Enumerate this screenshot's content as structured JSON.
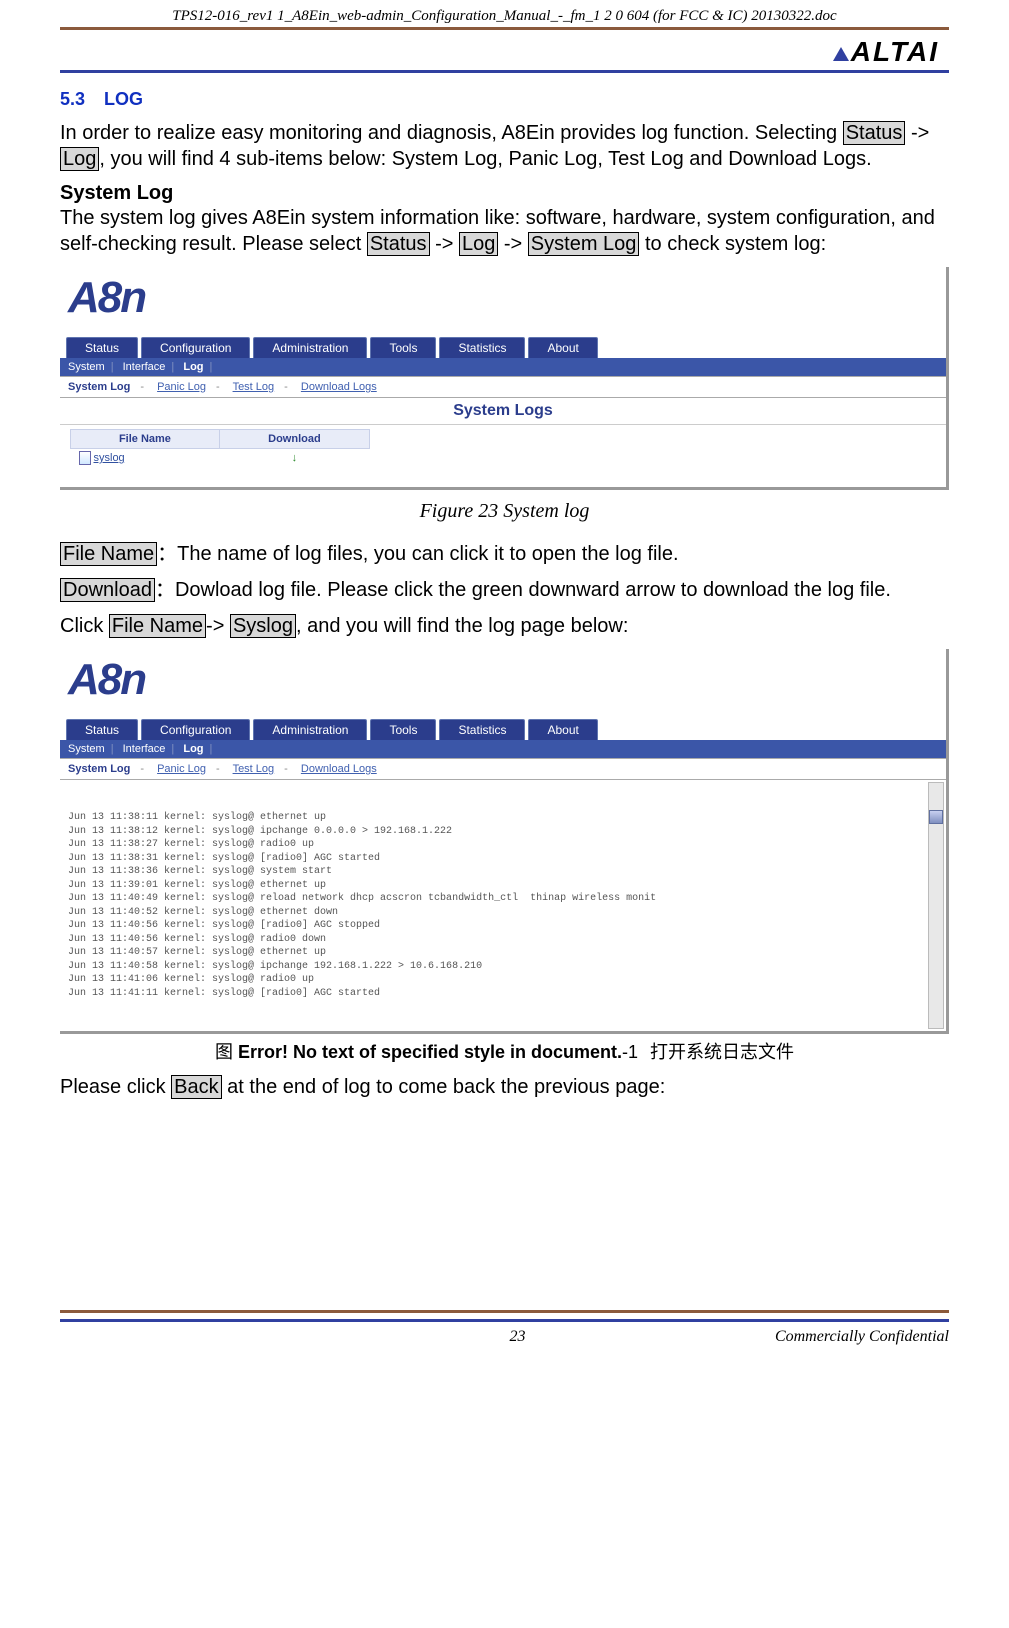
{
  "doc_header": "TPS12-016_rev1 1_A8Ein_web-admin_Configuration_Manual_-_fm_1 2 0 604 (for FCC & IC) 20130322.doc",
  "logo_text": "ALTAI",
  "section": {
    "num": "5.3",
    "title": "LOG"
  },
  "intro": {
    "p1a": "In order to realize easy monitoring and diagnosis, A8Ein provides log function. Selecting ",
    "status": "Status",
    "arrow1": " -> ",
    "log": "Log",
    "p1b": ", you will find 4 sub-items below: System Log, Panic Log, Test Log and Download Logs."
  },
  "syslog_heading": "System Log",
  "syslog_desc": {
    "a": "The system log gives A8Ein system information like: software, hardware, system configuration, and self-checking result. Please select ",
    "status": "Status",
    "arr": " -> ",
    "log": "Log",
    "systemlog": "System Log",
    "b": " to check system log:"
  },
  "a8n_logo": "A8n",
  "main_tabs": [
    "Status",
    "Configuration",
    "Administration",
    "Tools",
    "Statistics",
    "About"
  ],
  "sub_nav": {
    "items": [
      "System",
      "Interface",
      "Log"
    ],
    "active": "Log"
  },
  "log_tabs": [
    "System Log",
    "Panic Log",
    "Test Log",
    "Download Logs"
  ],
  "panel_title": "System Logs",
  "table": {
    "headers": [
      "File Name",
      "Download"
    ],
    "row": {
      "name": "syslog"
    }
  },
  "figure_caption": "Figure 23 System log",
  "filename_label": "File Name",
  "filename_desc": "：The name of log files, you can click it to open the log file.",
  "download_label": "Download",
  "download_desc": "：Dowload log file. Please click the green downward arrow to download the log file.",
  "click_line": {
    "a": "Click ",
    "fn": "File Name",
    "arr": "-> ",
    "sl": "Syslog",
    "b": ", and you will find the log page below:"
  },
  "log_lines": [
    "Jun 13 11:38:11 kernel: syslog@ ethernet up",
    "Jun 13 11:38:12 kernel: syslog@ ipchange 0.0.0.0 > 192.168.1.222",
    "Jun 13 11:38:27 kernel: syslog@ radio0 up",
    "Jun 13 11:38:31 kernel: syslog@ [radio0] AGC started",
    "Jun 13 11:38:36 kernel: syslog@ system start",
    "Jun 13 11:39:01 kernel: syslog@ ethernet up",
    "Jun 13 11:40:49 kernel: syslog@ reload network dhcp acscron tcbandwidth_ctl  thinap wireless monit",
    "Jun 13 11:40:52 kernel: syslog@ ethernet down",
    "Jun 13 11:40:56 kernel: syslog@ [radio0] AGC stopped",
    "Jun 13 11:40:56 kernel: syslog@ radio0 down",
    "Jun 13 11:40:57 kernel: syslog@ ethernet up",
    "Jun 13 11:40:58 kernel: syslog@ ipchange 192.168.1.222 > 10.6.168.210",
    "Jun 13 11:41:06 kernel: syslog@ radio0 up",
    "Jun 13 11:41:11 kernel: syslog@ [radio0] AGC started"
  ],
  "error_caption": {
    "prefix": "图  ",
    "bold": "Error! No text of specified style in document.",
    "suffix": "-1",
    "cn": "打开系统日志文件"
  },
  "back_line": {
    "a": "Please click ",
    "back": "Back",
    "b": " at the end of log to come back the previous page:"
  },
  "footer": {
    "page": "23",
    "conf": "Commercially Confidential"
  }
}
